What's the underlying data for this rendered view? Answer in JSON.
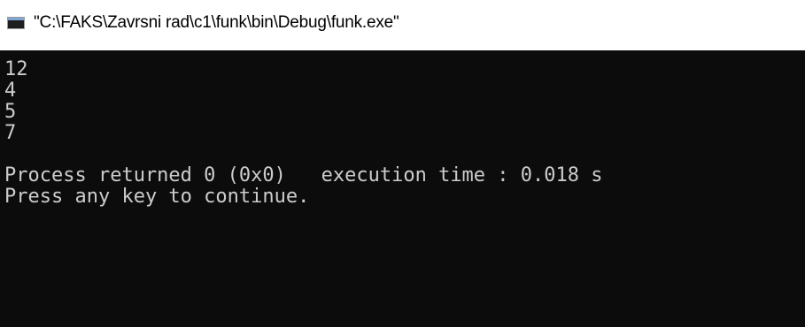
{
  "window": {
    "title": "\"C:\\FAKS\\Zavrsni rad\\c1\\funk\\bin\\Debug\\funk.exe\"",
    "icon": "console-window-icon"
  },
  "console": {
    "lines": [
      "12",
      "4",
      "5",
      "7",
      "",
      "Process returned 0 (0x0)   execution time : 0.018 s",
      "Press any key to continue."
    ]
  },
  "colors": {
    "console_background": "#0c0c0c",
    "console_text": "#cccccc",
    "titlebar_background": "#ffffff"
  }
}
